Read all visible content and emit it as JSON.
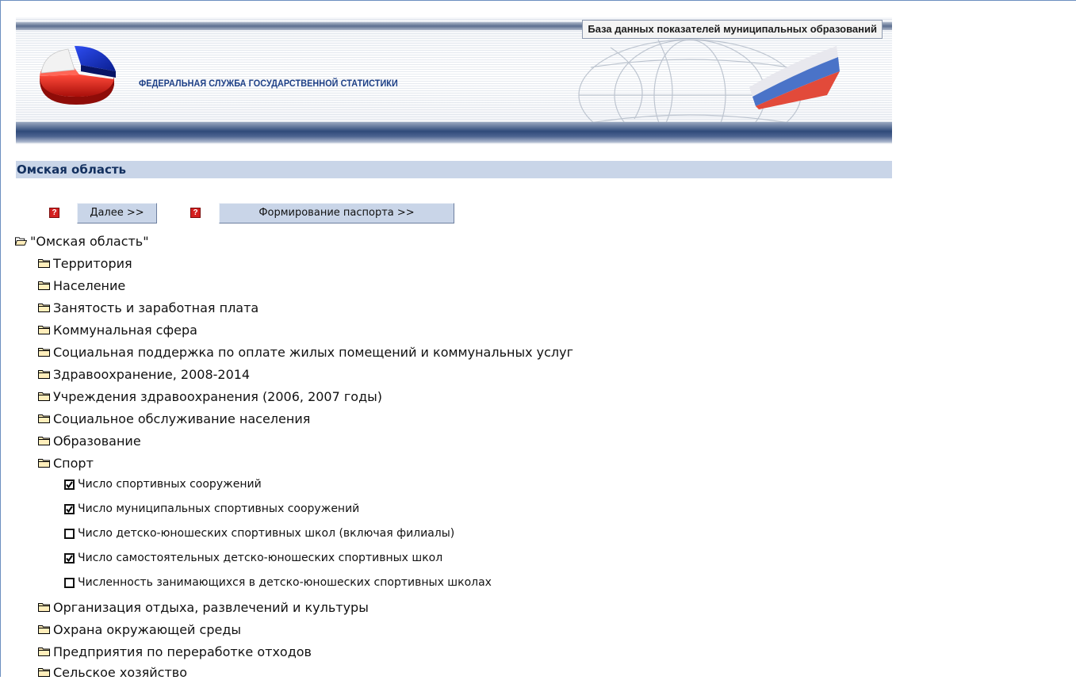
{
  "banner": {
    "db_title": "База данных показателей муниципальных образований",
    "org_title": "ФЕДЕРАЛЬНАЯ СЛУЖБА ГОСУДАРСТВЕННОЙ СТАТИСТИКИ"
  },
  "region": {
    "title": "Омская область"
  },
  "toolbar": {
    "next_label": "Далее >>",
    "passport_label": "Формирование паспорта >>",
    "help_glyph": "?"
  },
  "tree": {
    "root": "\"Омская область\"",
    "sections": [
      "Территория",
      "Население",
      "Занятость и заработная плата",
      "Коммунальная сфера",
      "Социальная поддержка по оплате жилых помещений и коммунальных услуг",
      "Здравоохранение, 2008-2014",
      "Учреждения здравоохранения (2006, 2007 годы)",
      "Социальное обслуживание населения",
      "Образование",
      "Спорт"
    ],
    "sport_items": [
      {
        "label": "Число спортивных сооружений",
        "checked": true
      },
      {
        "label": "Число муниципальных спортивных сооружений",
        "checked": true
      },
      {
        "label": "Число детско-юношеских спортивных школ (включая филиалы)",
        "checked": false
      },
      {
        "label": "Число самостоятельных детско-юношеских спортивных школ",
        "checked": true
      },
      {
        "label": "Численность занимающихся в детско-юношеских спортивных школах",
        "checked": false
      }
    ],
    "after_sections": [
      "Организация отдыха, развлечений и культуры",
      "Охрана окружающей среды",
      "Предприятия по переработке отходов",
      "Сельское хозяйство"
    ]
  },
  "colors": {
    "region_bar_bg": "#c9d5e8",
    "region_text": "#13305f",
    "org_title": "#1d3f86",
    "help_icon": "#d42020"
  }
}
